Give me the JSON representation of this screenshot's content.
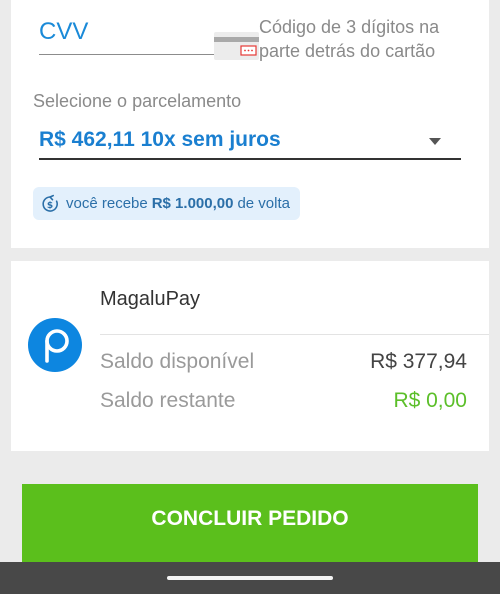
{
  "payment": {
    "cvv_placeholder": "CVV",
    "cvv_hint": "Código de 3 dígitos na parte detrás do cartão",
    "installment_label": "Selecione o parcelamento",
    "installment_selected": "R$ 462,11 10x sem juros",
    "cashback": {
      "prefix": "você recebe",
      "amount": "R$ 1.000,00",
      "suffix": "de volta"
    }
  },
  "wallet": {
    "name": "MagaluPay",
    "logo_letter": "p",
    "available_label": "Saldo disponível",
    "available_value": "R$ 377,94",
    "remaining_label": "Saldo restante",
    "remaining_value": "R$ 0,00"
  },
  "actions": {
    "submit_label": "CONCLUIR PEDIDO"
  },
  "icons": {
    "card": "credit-card-icon",
    "cashback": "cashback-icon",
    "dropdown": "chevron-down-icon",
    "wallet": "magalupay-logo"
  },
  "colors": {
    "accent_blue": "#1a7fd0",
    "success_green": "#5bbf1c",
    "remaining_green": "#5cbf2a",
    "badge_bg": "#e3f0fc"
  }
}
